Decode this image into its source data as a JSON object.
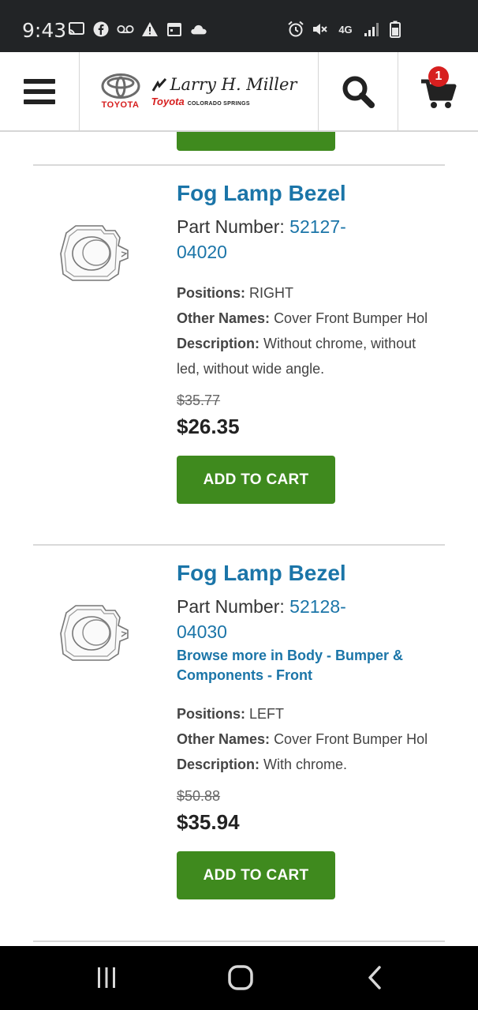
{
  "status_bar": {
    "time": "9:43",
    "left_icons": [
      "cast-icon",
      "facebook-icon",
      "voicemail-icon",
      "warning-icon",
      "calendar-icon",
      "cloud-icon"
    ],
    "right_icons": [
      "alarm-icon",
      "mute-icon",
      "4g-lte-icon",
      "signal-icon",
      "battery-icon"
    ],
    "network_label": "4G"
  },
  "header": {
    "brand": "TOYOTA",
    "dealer_script": "Larry H. Miller",
    "dealer_toyota": "Toyota",
    "dealer_city": "COLORADO SPRINGS",
    "cart_count": "1"
  },
  "products": [
    {
      "title": "Fog Lamp Bezel",
      "part_number_label": "Part Number:",
      "part_number_line1": "52127-",
      "part_number_line2": "04020",
      "positions_label": "Positions:",
      "positions": "RIGHT",
      "other_names_label": "Other Names:",
      "other_names": "Cover Front Bumper Hol",
      "description_label": "Description:",
      "description": "Without chrome, without led, without wide angle.",
      "old_price": "$35.77",
      "price": "$26.35",
      "button": "ADD TO CART"
    },
    {
      "title": "Fog Lamp Bezel",
      "part_number_label": "Part Number:",
      "part_number_line1": "52128-",
      "part_number_line2": "04030",
      "browse_link": "Browse more in Body - Bumper & Components - Front",
      "positions_label": "Positions:",
      "positions": "LEFT",
      "other_names_label": "Other Names:",
      "other_names": "Cover Front Bumper Hol",
      "description_label": "Description:",
      "description": "With chrome.",
      "old_price": "$50.88",
      "price": "$35.94",
      "button": "ADD TO CART"
    }
  ],
  "colors": {
    "link_blue": "#1b75a8",
    "button_green": "#3f8a1e",
    "badge_red": "#d71f1f"
  }
}
